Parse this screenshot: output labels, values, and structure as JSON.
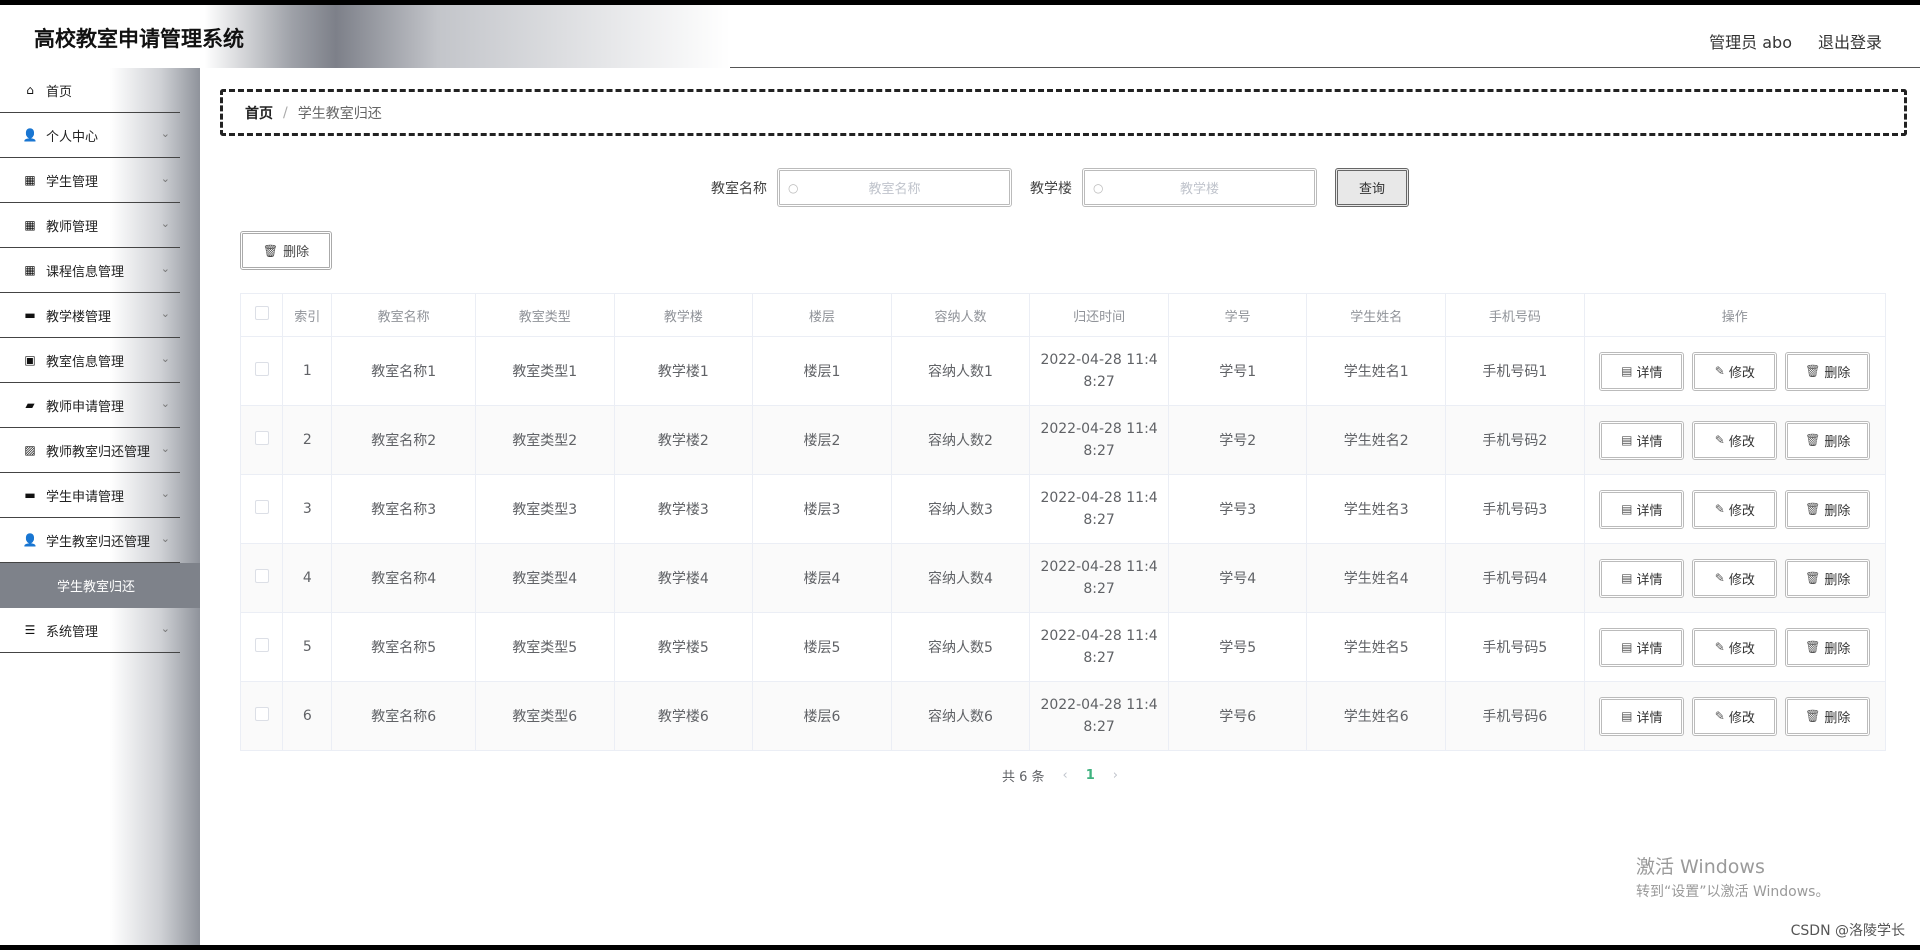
{
  "app": {
    "title": "高校教室申请管理系统",
    "user": "管理员 abo",
    "logout": "退出登录"
  },
  "sidebar": {
    "items": [
      {
        "label": "首页",
        "icon": "home-icon",
        "glyph": "⌂",
        "chevron": false
      },
      {
        "label": "个人中心",
        "icon": "person-icon",
        "glyph": "👤",
        "chevron": true
      },
      {
        "label": "学生管理",
        "icon": "grid-icon",
        "glyph": "▦",
        "chevron": true
      },
      {
        "label": "教师管理",
        "icon": "grid-icon",
        "glyph": "▦",
        "chevron": true
      },
      {
        "label": "课程信息管理",
        "icon": "grid-icon",
        "glyph": "▦",
        "chevron": true
      },
      {
        "label": "教学楼管理",
        "icon": "monitor-icon",
        "glyph": "▬",
        "chevron": true
      },
      {
        "label": "教室信息管理",
        "icon": "clipboard-icon",
        "glyph": "▣",
        "chevron": true
      },
      {
        "label": "教师申请管理",
        "icon": "briefcase-icon",
        "glyph": "▰",
        "chevron": true
      },
      {
        "label": "教师教室归还管理",
        "icon": "chart-icon",
        "glyph": "▨",
        "chevron": true
      },
      {
        "label": "学生申请管理",
        "icon": "box-icon",
        "glyph": "▬",
        "chevron": true
      },
      {
        "label": "学生教室归还管理",
        "icon": "person-icon",
        "glyph": "👤",
        "chevron": true
      }
    ],
    "active_sub": "学生教室归还",
    "last_item": {
      "label": "系统管理",
      "icon": "list-icon",
      "glyph": "☰",
      "chevron": true
    }
  },
  "breadcrumb": {
    "home": "首页",
    "sep": "/",
    "current": "学生教室归还"
  },
  "search": {
    "classroom_label": "教室名称",
    "classroom_placeholder": "教室名称",
    "building_label": "教学楼",
    "building_placeholder": "教学楼",
    "query_button": "查询"
  },
  "toolbar": {
    "delete_label": "删除"
  },
  "table": {
    "headers": [
      "索引",
      "教室名称",
      "教室类型",
      "教学楼",
      "楼层",
      "容纳人数",
      "归还时间",
      "学号",
      "学生姓名",
      "手机号码",
      "操作"
    ],
    "rows": [
      [
        "1",
        "教室名称1",
        "教室类型1",
        "教学楼1",
        "楼层1",
        "容纳人数1",
        "2022-04-28 11:48:27",
        "学号1",
        "学生姓名1",
        "手机号码1"
      ],
      [
        "2",
        "教室名称2",
        "教室类型2",
        "教学楼2",
        "楼层2",
        "容纳人数2",
        "2022-04-28 11:48:27",
        "学号2",
        "学生姓名2",
        "手机号码2"
      ],
      [
        "3",
        "教室名称3",
        "教室类型3",
        "教学楼3",
        "楼层3",
        "容纳人数3",
        "2022-04-28 11:48:27",
        "学号3",
        "学生姓名3",
        "手机号码3"
      ],
      [
        "4",
        "教室名称4",
        "教室类型4",
        "教学楼4",
        "楼层4",
        "容纳人数4",
        "2022-04-28 11:48:27",
        "学号4",
        "学生姓名4",
        "手机号码4"
      ],
      [
        "5",
        "教室名称5",
        "教室类型5",
        "教学楼5",
        "楼层5",
        "容纳人数5",
        "2022-04-28 11:48:27",
        "学号5",
        "学生姓名5",
        "手机号码5"
      ],
      [
        "6",
        "教室名称6",
        "教室类型6",
        "教学楼6",
        "楼层6",
        "容纳人数6",
        "2022-04-28 11:48:27",
        "学号6",
        "学生姓名6",
        "手机号码6"
      ]
    ],
    "actions": {
      "detail": "详情",
      "edit": "修改",
      "delete": "删除"
    }
  },
  "pagination": {
    "total": "共 6 条",
    "current_page": "1"
  },
  "watermark": {
    "line1": "激活 Windows",
    "line2": "转到“设置”以激活 Windows。"
  },
  "credit": "CSDN @洛陵学长"
}
